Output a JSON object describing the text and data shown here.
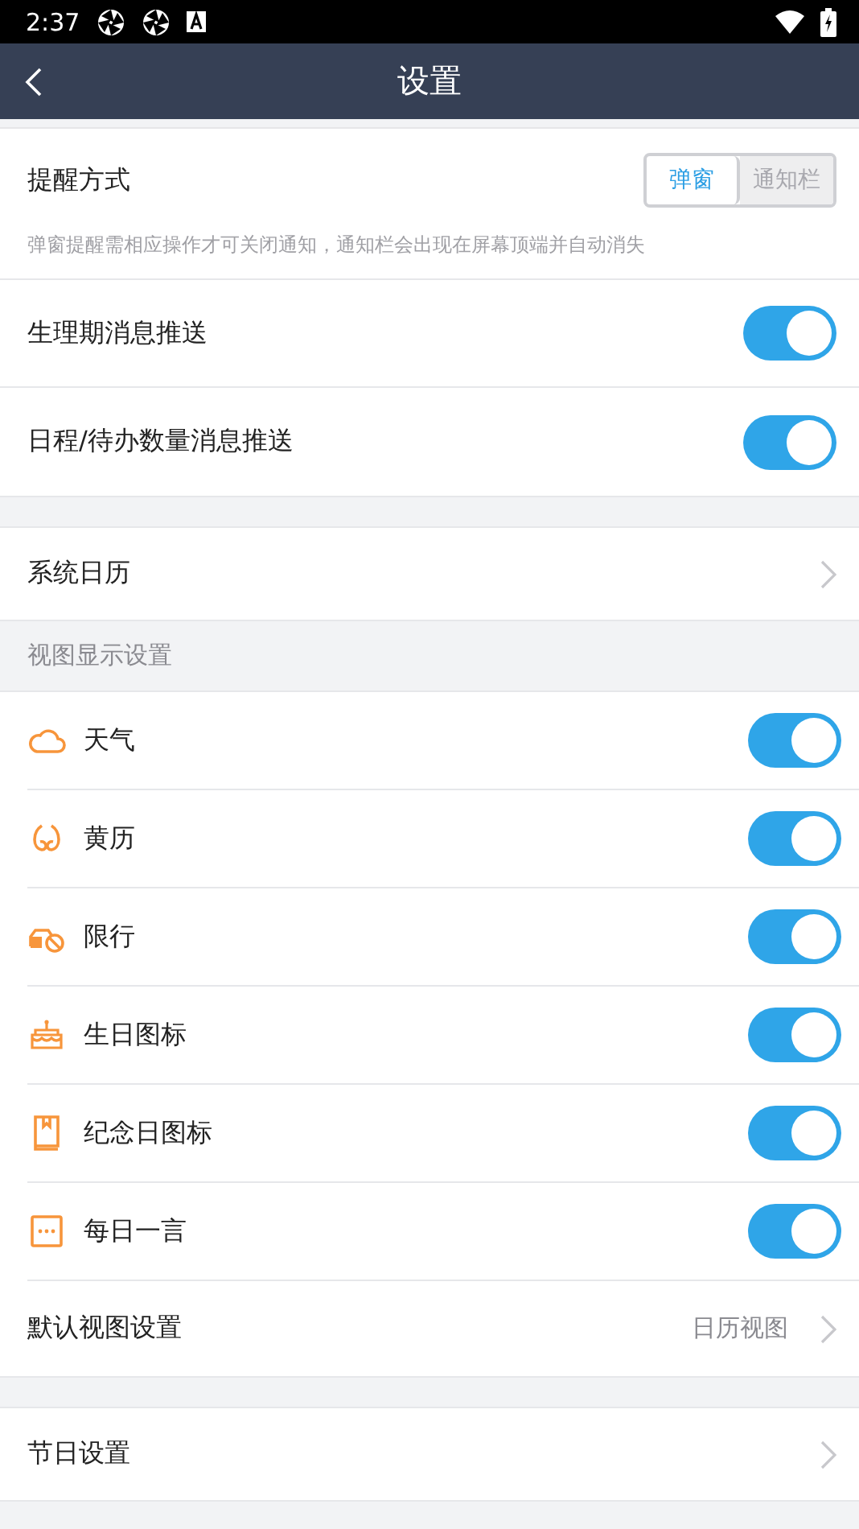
{
  "status_bar": {
    "time": "2:37"
  },
  "header": {
    "title": "设置"
  },
  "reminder": {
    "label": "提醒方式",
    "options": [
      {
        "label": "弹窗",
        "selected": true
      },
      {
        "label": "通知栏",
        "selected": false
      }
    ],
    "hint": "弹窗提醒需相应操作才可关闭通知，通知栏会出现在屏幕顶端并自动消失"
  },
  "push_settings": [
    {
      "label": "生理期消息推送",
      "on": true
    },
    {
      "label": "日程/待办数量消息推送",
      "on": true
    }
  ],
  "system_calendar": {
    "label": "系统日历"
  },
  "view_section": {
    "title": "视图显示设置",
    "items": [
      {
        "label": "天气",
        "on": true
      },
      {
        "label": "黄历",
        "on": true
      },
      {
        "label": "限行",
        "on": true
      },
      {
        "label": "生日图标",
        "on": true
      },
      {
        "label": "纪念日图标",
        "on": true
      },
      {
        "label": "每日一言",
        "on": true
      }
    ]
  },
  "default_view": {
    "label": "默认视图设置",
    "value": "日历视图"
  },
  "holiday_settings": {
    "label": "节日设置"
  }
}
